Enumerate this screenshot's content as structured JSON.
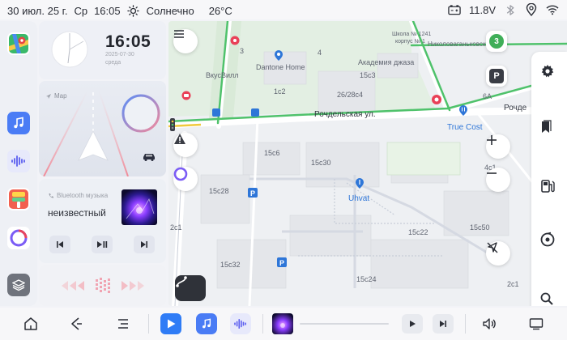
{
  "status_bar": {
    "date": "30 июл. 25 г.",
    "weekday": "Ср",
    "time": "16:05",
    "weather": "Солнечно",
    "temperature": "26°C",
    "voltage": "11.8V"
  },
  "clock_widget": {
    "time": "16:05",
    "date": "2025-07-30",
    "weekday": "среда"
  },
  "nav_widget": {
    "label": "Map"
  },
  "music_widget": {
    "source": "Bluetooth музыка",
    "track": "неизвестный"
  },
  "map": {
    "streets": {
      "rochdelskaya": "Рочдельская ул.",
      "rochdelskaya_cut": "Рочде",
      "nikolovagankovsky": "Николоваганьковский",
      "shkola": "Школа № 1241",
      "korpus": "корпус № 1"
    },
    "pois": {
      "vkusvill": "ВкусВилл",
      "dantone": "Dantone Home",
      "academy": "Академия джаза",
      "truecost": "True Cost",
      "uhvat": "Uhvat"
    },
    "buildings": [
      "1с2",
      "26/28с4",
      "15с6",
      "15с30",
      "15с28",
      "15с22",
      "15с50",
      "15с32",
      "15с24",
      "2с1",
      "2с1",
      "3",
      "4",
      "6А",
      "4с1",
      "15с3"
    ],
    "traffic_badge": "3",
    "parking_label": "P"
  },
  "colors": {
    "accent": "#2f7cf6",
    "road_green": "#4fc26b",
    "alice_purple": "#7b5cf5",
    "poi_blue": "#2e76d8"
  }
}
